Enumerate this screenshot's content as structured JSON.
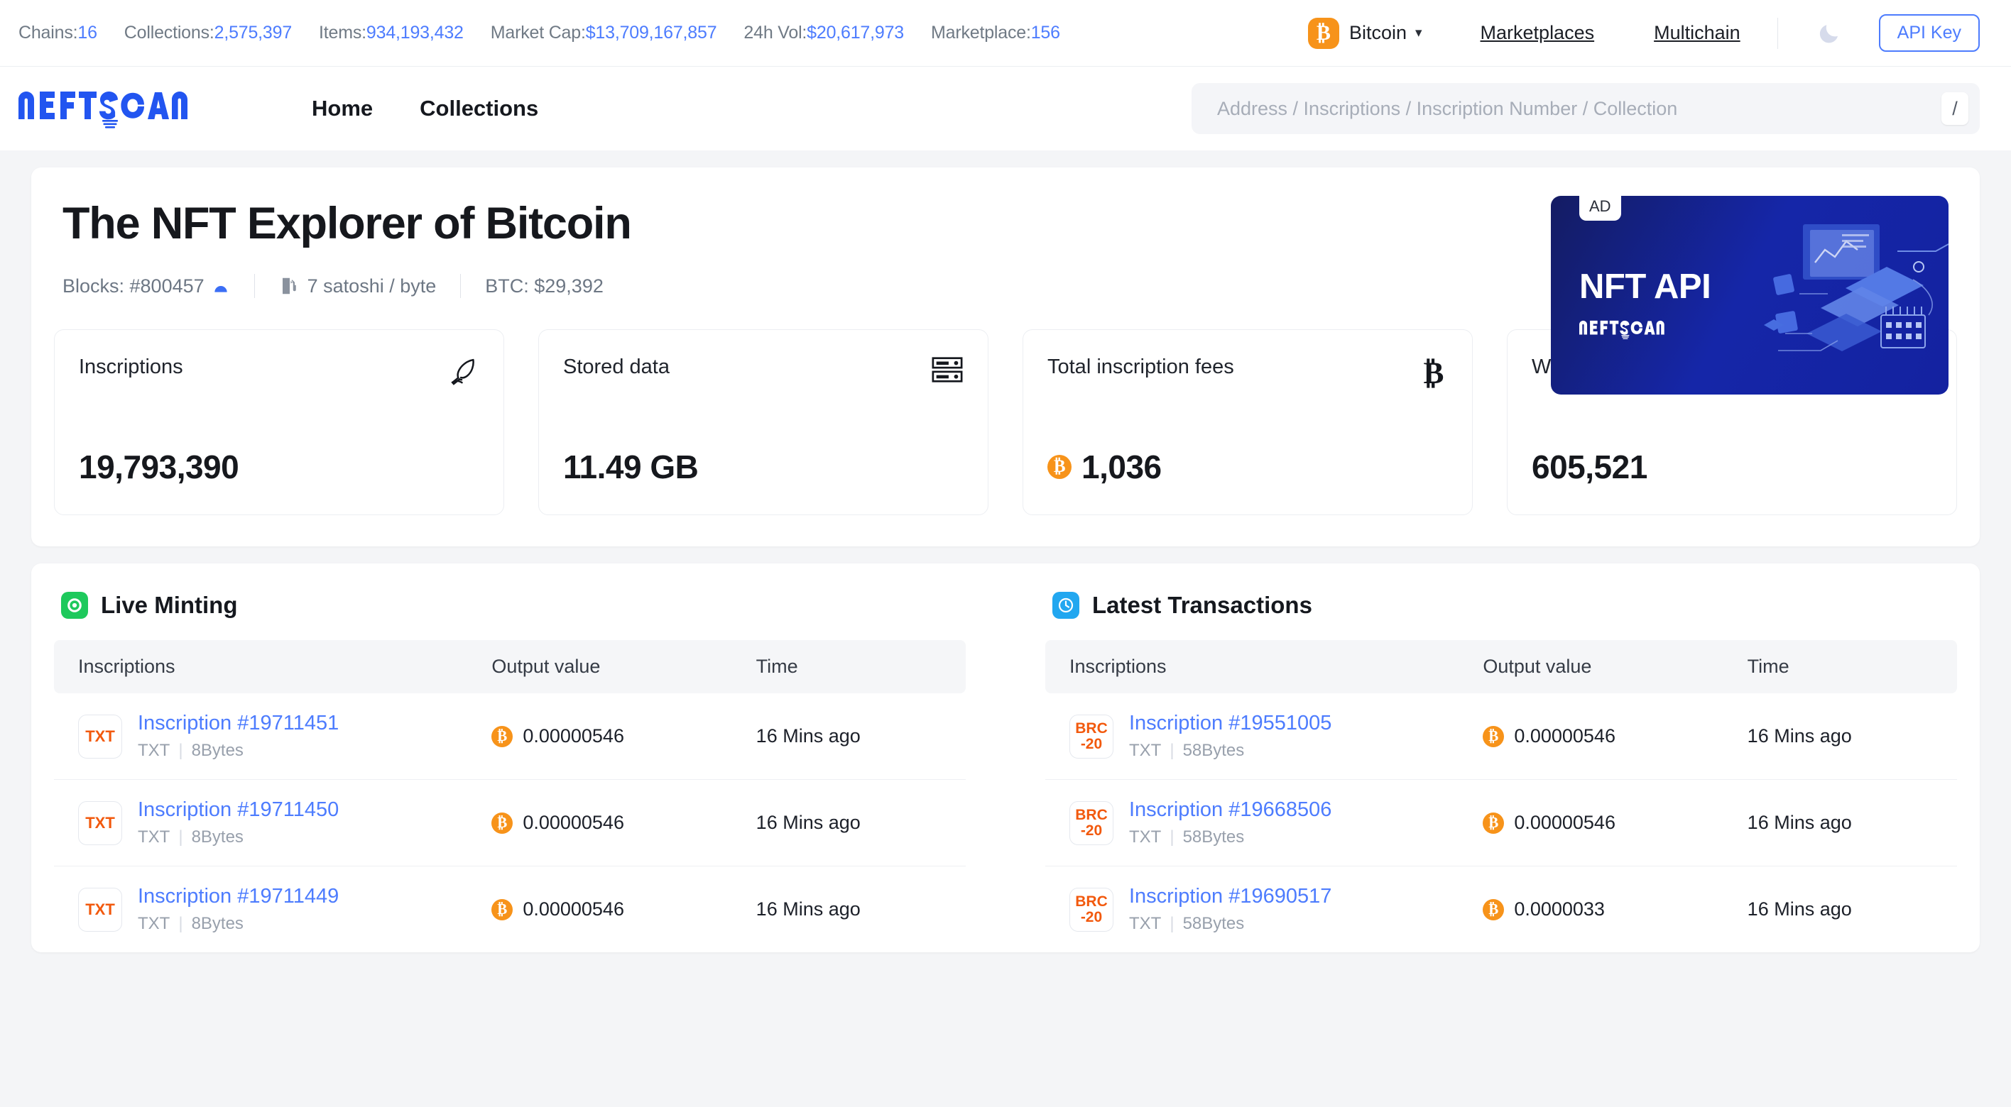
{
  "topbar": {
    "stats": [
      {
        "label": "Chains:",
        "value": "16"
      },
      {
        "label": "Collections:",
        "value": "2,575,397"
      },
      {
        "label": "Items:",
        "value": "934,193,432"
      },
      {
        "label": "Market Cap:",
        "value": "$13,709,167,857"
      },
      {
        "label": "24h Vol:",
        "value": "$20,617,973"
      },
      {
        "label": "Marketplace:",
        "value": "156"
      }
    ],
    "chain_selector": {
      "label": "Bitcoin",
      "icon": "bitcoin-icon",
      "caret": "⌄"
    },
    "links": [
      {
        "label": "Marketplaces",
        "name": "marketplaces"
      },
      {
        "label": "Multichain",
        "name": "multichain"
      }
    ],
    "theme_toggle_icon": "moon-icon",
    "api_key_label": "API Key"
  },
  "header": {
    "logo_text": "NFTSCAN",
    "nav": [
      {
        "label": "Home",
        "name": "home"
      },
      {
        "label": "Collections",
        "name": "collections"
      }
    ],
    "search": {
      "placeholder": "Address / Inscriptions / Inscription Number / Collection",
      "value": "",
      "shortcut": "/"
    }
  },
  "hero": {
    "title": "The NFT Explorer of Bitcoin",
    "blocks_label": "Blocks: #800457",
    "fee": "7 satoshi / byte",
    "btc_price": "BTC: $29,392",
    "ad": {
      "tag": "AD",
      "title": "NFT API",
      "brand": "NFTSCAN"
    }
  },
  "cards": [
    {
      "label": "Inscriptions",
      "value": "19,793,390",
      "icon": "quill-pen-icon",
      "prefix": ""
    },
    {
      "label": "Stored data",
      "value": "11.49 GB",
      "icon": "server-rack-icon",
      "prefix": ""
    },
    {
      "label": "Total inscription fees",
      "value": "1,036",
      "icon": "bitcoin-symbol-icon",
      "prefix": "btc-coin"
    },
    {
      "label": "Wallet Address",
      "value": "605,521",
      "icon": "wallet-icon",
      "prefix": ""
    }
  ],
  "columns": [
    "Inscriptions",
    "Output value",
    "Time"
  ],
  "live_minting": {
    "title": "Live Minting",
    "icon": "green-record-icon",
    "rows": [
      {
        "badge": "TXT",
        "badge_lines": [
          "TXT"
        ],
        "title": "Inscription #19711451",
        "type": "TXT",
        "size": "8Bytes",
        "output": "0.00000546",
        "time": "16 Mins ago"
      },
      {
        "badge": "TXT",
        "badge_lines": [
          "TXT"
        ],
        "title": "Inscription #19711450",
        "type": "TXT",
        "size": "8Bytes",
        "output": "0.00000546",
        "time": "16 Mins ago"
      },
      {
        "badge": "TXT",
        "badge_lines": [
          "TXT"
        ],
        "title": "Inscription #19711449",
        "type": "TXT",
        "size": "8Bytes",
        "output": "0.00000546",
        "time": "16 Mins ago"
      }
    ]
  },
  "latest_transactions": {
    "title": "Latest Transactions",
    "icon": "blue-clock-icon",
    "rows": [
      {
        "badge": "BRC-20",
        "badge_lines": [
          "BRC",
          "-20"
        ],
        "title": "Inscription #19551005",
        "type": "TXT",
        "size": "58Bytes",
        "output": "0.00000546",
        "time": "16 Mins ago"
      },
      {
        "badge": "BRC-20",
        "badge_lines": [
          "BRC",
          "-20"
        ],
        "title": "Inscription #19668506",
        "type": "TXT",
        "size": "58Bytes",
        "output": "0.00000546",
        "time": "16 Mins ago"
      },
      {
        "badge": "BRC-20",
        "badge_lines": [
          "BRC",
          "-20"
        ],
        "title": "Inscription #19690517",
        "type": "TXT",
        "size": "58Bytes",
        "output": "0.0000033",
        "time": "16 Mins ago"
      }
    ]
  },
  "colors": {
    "accent_blue": "#4d7cfe",
    "bitcoin_orange": "#f7931a",
    "badge_orange": "#f2590d",
    "live_green": "#1ec95c",
    "clock_blue": "#22a7f0",
    "page_bg": "#f4f5f7"
  }
}
